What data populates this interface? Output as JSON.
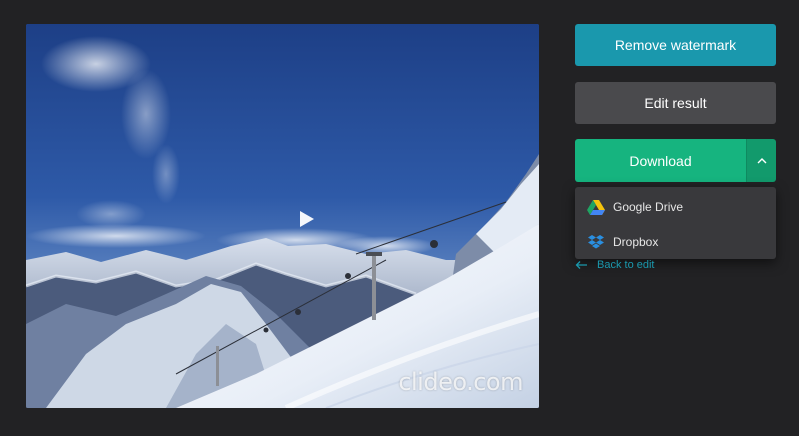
{
  "preview": {
    "watermark": "clideo.com"
  },
  "actions": {
    "remove_watermark_label": "Remove watermark",
    "edit_result_label": "Edit result",
    "download_label": "Download"
  },
  "download_menu": {
    "items": [
      {
        "label": "Google Drive",
        "icon": "google-drive-icon"
      },
      {
        "label": "Dropbox",
        "icon": "dropbox-icon"
      }
    ]
  },
  "back_link": {
    "label": "Back to edit",
    "icon": "arrow-left-icon"
  },
  "colors": {
    "background": "#222224",
    "remove_watermark": "#1a98ad",
    "edit_result": "#4a4a4d",
    "download": "#16b47f",
    "download_toggle": "#129a6c",
    "dropdown_bg": "#39393c",
    "link": "#1a98ad"
  }
}
